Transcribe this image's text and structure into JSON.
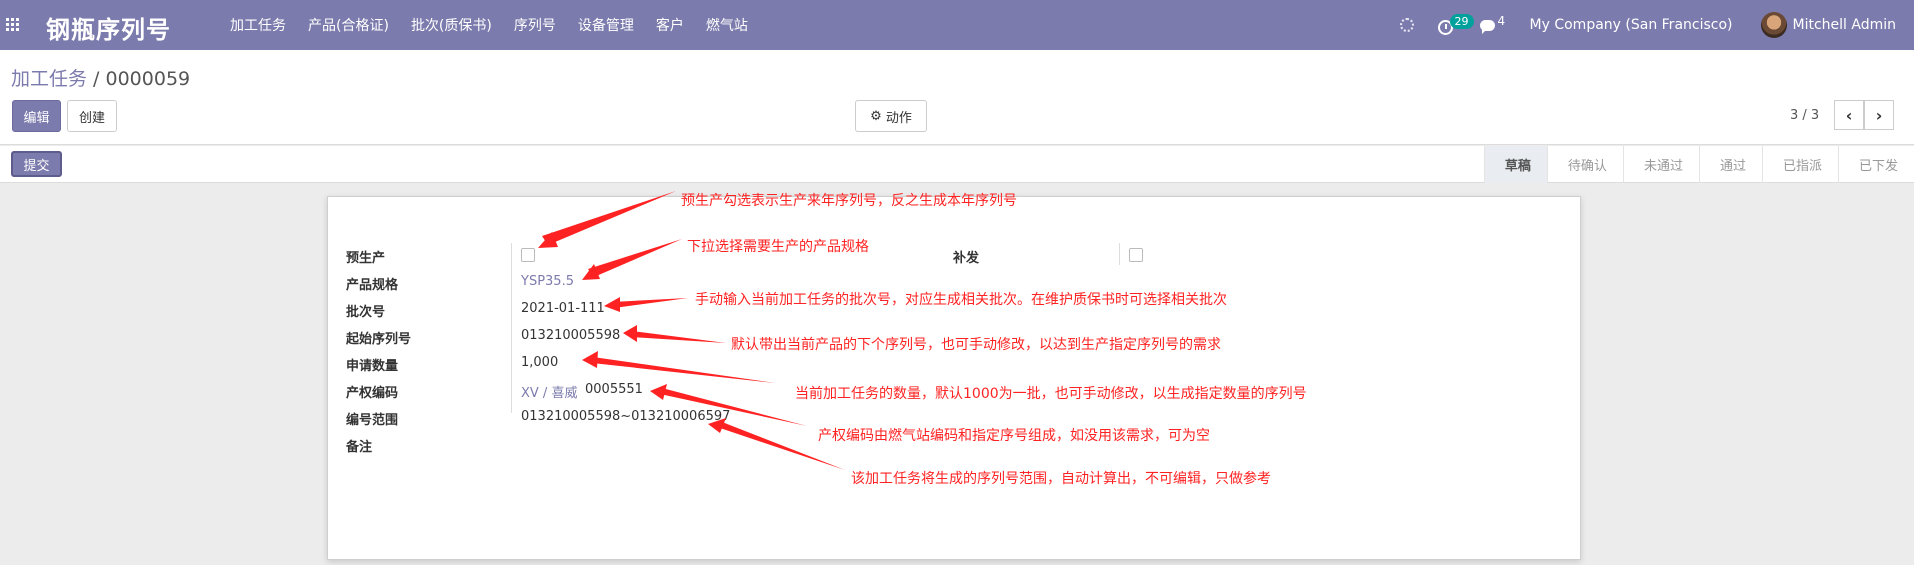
{
  "navbar": {
    "brand": "钢瓶序列号",
    "menu": [
      "加工任务",
      "产品(合格证)",
      "批次(质保书)",
      "序列号",
      "设备管理",
      "客户",
      "燃气站"
    ],
    "activity_count": "29",
    "message_count": "4",
    "company": "My Company (San Francisco)",
    "user": "Mitchell Admin"
  },
  "control": {
    "breadcrumb_parent": "加工任务",
    "breadcrumb_sep": " / ",
    "breadcrumb_current": "0000059",
    "edit_label": "编辑",
    "create_label": "创建",
    "action_label": "动作",
    "pager": "3 / 3",
    "prev": "‹",
    "next": "›"
  },
  "statusbar": {
    "submit_label": "提交",
    "stages": [
      "草稿",
      "待确认",
      "未通过",
      "通过",
      "已指派",
      "已下发"
    ],
    "active_stage": "草稿"
  },
  "form": {
    "pre_production_label": "预生产",
    "product_spec_label": "产品规格",
    "product_spec_value": "YSP35.5",
    "batch_label": "批次号",
    "batch_value": "2021-01-111",
    "start_serial_label": "起始序列号",
    "start_serial_value": "013210005598",
    "quantity_label": "申请数量",
    "quantity_value": "1,000",
    "property_code_label": "产权编码",
    "property_code_station": "XV / 喜威",
    "property_code_number": "0005551",
    "serial_range_label": "编号范围",
    "serial_range_value": "013210005598~013210006597",
    "remark_label": "备注",
    "reissue_label": "补发"
  },
  "annotations": [
    "预生产勾选表示生产来年序列号，反之生成本年序列号",
    "下拉选择需要生产的产品规格",
    "手动输入当前加工任务的批次号，对应生成相关批次。在维护质保书时可选择相关批次",
    "默认带出当前产品的下个序列号，也可手动修改，以达到生产指定序列号的需求",
    "当前加工任务的数量，默认1000为一批，也可手动修改，以生成指定数量的序列号",
    "产权编码由燃气站编码和指定序号组成，如没用该需求，可为空",
    "该加工任务将生成的序列号范围，自动计算出，不可编辑，只做参考"
  ],
  "colors": {
    "primary": "#7c7bad",
    "annotation": "#ff2222",
    "badge": "#00a09d"
  }
}
